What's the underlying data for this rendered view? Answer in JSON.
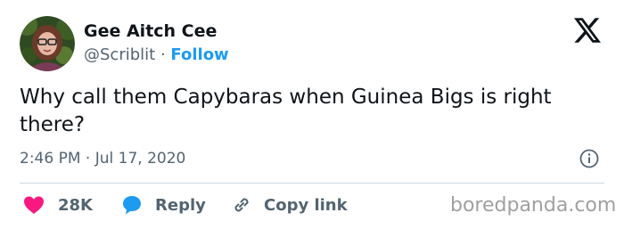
{
  "author": {
    "display_name": "Gee Aitch Cee",
    "handle": "@Scriblit",
    "separator": "·",
    "follow_label": "Follow"
  },
  "brand": {
    "logo_icon": "x-logo-icon"
  },
  "tweet": {
    "text": "Why call them Capybaras when Guinea Bigs is right there?",
    "time": "2:46 PM",
    "separator": "·",
    "date": "Jul 17, 2020"
  },
  "actions": {
    "like": {
      "icon": "heart-icon",
      "count": "28K",
      "color": "#f91880"
    },
    "reply": {
      "icon": "reply-bubble-icon",
      "label": "Reply",
      "color": "#1d9bf0"
    },
    "copy_link": {
      "icon": "link-icon",
      "label": "Copy link"
    }
  },
  "watermark": "boredpanda.com",
  "colors": {
    "text_primary": "#0f1419",
    "text_secondary": "#536471",
    "accent": "#1d9bf0",
    "like": "#f91880",
    "divider": "#cfd9de"
  }
}
